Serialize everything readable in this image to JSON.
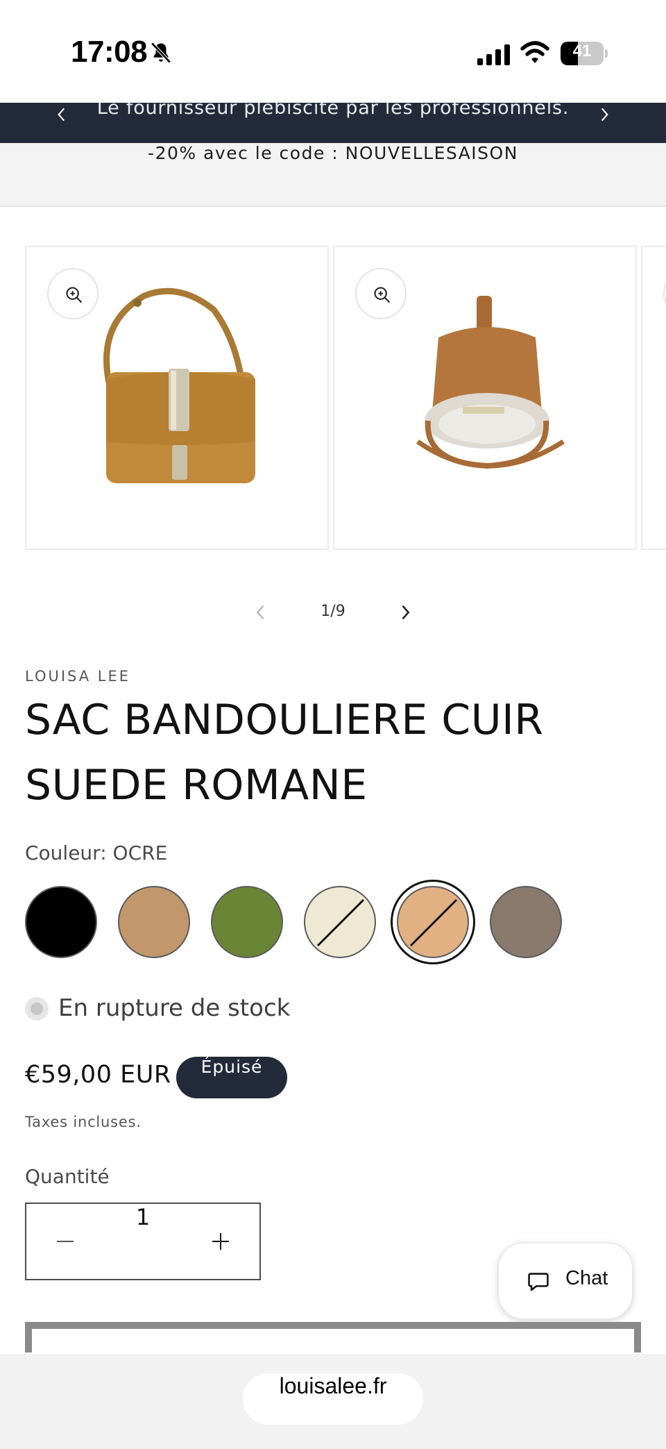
{
  "status_bar": {
    "time": "17:08",
    "battery": "41",
    "battery_level": 0.41
  },
  "announcement": {
    "text": "Le fournisseur plébiscité par les professionnels."
  },
  "promo": {
    "text": "-20% avec le code : NOUVELLESAISON"
  },
  "gallery": {
    "current": 1,
    "total": 9,
    "counter": "1/9"
  },
  "product": {
    "vendor": "LOUISA LEE",
    "title": "SAC BANDOULIERE CUIR SUEDE ROMANE",
    "color_label": "Couleur: OCRE",
    "swatches": [
      {
        "color": "#000000",
        "unavailable": false,
        "selected": false
      },
      {
        "color": "#c1976b",
        "unavailable": false,
        "selected": false
      },
      {
        "color": "#6b8537",
        "unavailable": false,
        "selected": false
      },
      {
        "color": "#efe8d2",
        "unavailable": true,
        "selected": false
      },
      {
        "color": "#e2b183",
        "unavailable": true,
        "selected": true
      },
      {
        "color": "#8a7a6e",
        "unavailable": false,
        "selected": false
      }
    ],
    "stock": "En rupture de stock",
    "price": "€59,00 EUR",
    "badge": "Épuisé",
    "tax": "Taxes incluses.",
    "quantity_label": "Quantité",
    "quantity": "1"
  },
  "chat": {
    "label": "Chat"
  },
  "browser": {
    "url": "louisalee.fr"
  },
  "colors": {
    "dark": "#232a39",
    "bag": "#c08a3a"
  }
}
